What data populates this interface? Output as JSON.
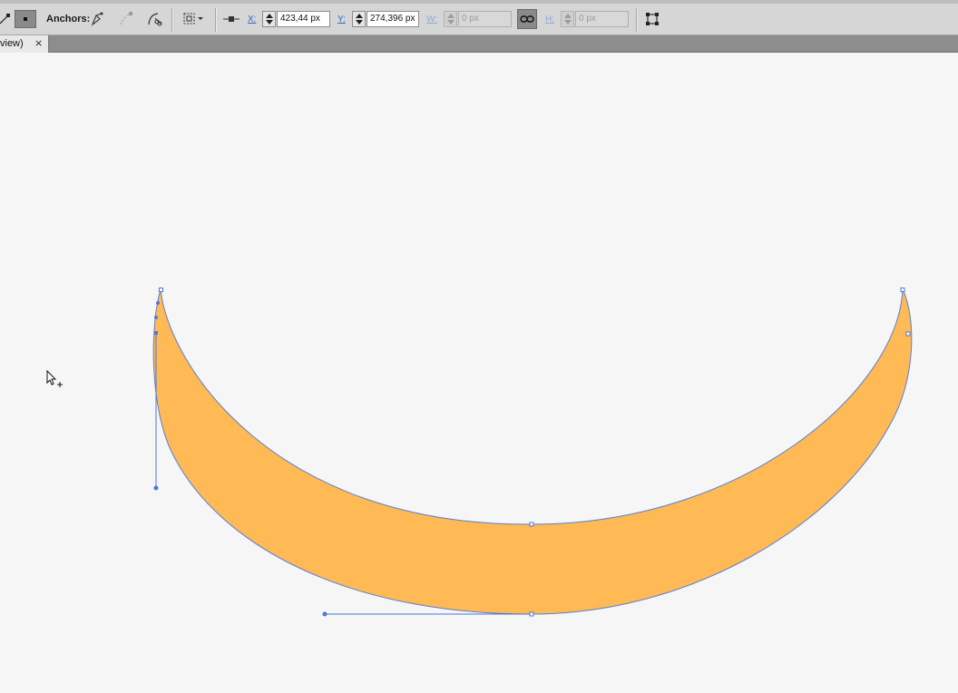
{
  "control_bar": {
    "anchors_label": "Anchors:",
    "x_label": "X:",
    "x_value": "423,44 px",
    "y_label": "Y:",
    "y_value": "274,396 px",
    "w_label": "W:",
    "w_value": "0 px",
    "h_label": "H:",
    "h_value": "0 px",
    "icons": [
      "show-handles-icon",
      "hide-handles-icon",
      "convert-anchor-icon",
      "remove-anchor-icon",
      "cut-path-icon",
      "isolate-selection-icon",
      "align-anchors-icon",
      "link-constrain-icon",
      "transform-icon"
    ]
  },
  "document_tab": {
    "label": "view)",
    "close": "×"
  },
  "artwork": {
    "fill_color": "#ffb955",
    "stroke_color": "#5b7fd0"
  },
  "colors": {
    "toolbar_bg": "#d6d6d6",
    "canvas_bg": "#f6f6f6",
    "selection_blue": "#4d78d6"
  }
}
